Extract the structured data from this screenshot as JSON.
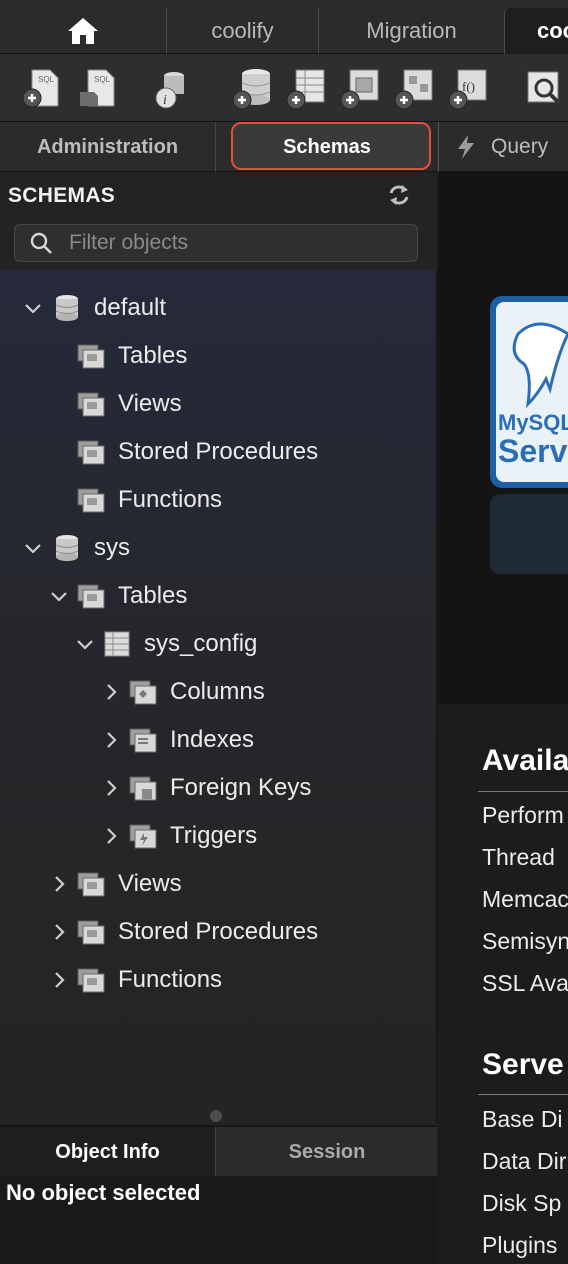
{
  "tabs": {
    "home_icon": "house-icon",
    "items": [
      {
        "label": "coolify"
      },
      {
        "label": "Migration"
      },
      {
        "label": "coo"
      }
    ]
  },
  "toolbar": {
    "buttons": [
      "new-sql-tab-icon",
      "open-sql-script-icon",
      "schema-inspector-icon",
      "create-schema-icon",
      "create-table-icon",
      "create-view-icon",
      "create-procedure-icon",
      "create-function-icon",
      "search-table-data-icon"
    ]
  },
  "sidebar_tabs": {
    "administration": "Administration",
    "schemas": "Schemas",
    "query": "Query"
  },
  "sidebar": {
    "title": "SCHEMAS",
    "filter_placeholder": "Filter objects",
    "tree": [
      {
        "label": "default",
        "kind": "schema",
        "expanded": true
      },
      {
        "label": "Tables",
        "kind": "folder"
      },
      {
        "label": "Views",
        "kind": "folder"
      },
      {
        "label": "Stored Procedures",
        "kind": "folder"
      },
      {
        "label": "Functions",
        "kind": "folder"
      },
      {
        "label": "sys",
        "kind": "schema",
        "expanded": true
      },
      {
        "label": "Tables",
        "kind": "folder",
        "expanded": true
      },
      {
        "label": "sys_config",
        "kind": "table",
        "expanded": true
      },
      {
        "label": "Columns",
        "kind": "columns",
        "expanded": false
      },
      {
        "label": "Indexes",
        "kind": "indexes",
        "expanded": false
      },
      {
        "label": "Foreign Keys",
        "kind": "foreign-keys",
        "expanded": false
      },
      {
        "label": "Triggers",
        "kind": "triggers",
        "expanded": false
      },
      {
        "label": "Views",
        "kind": "folder",
        "expanded": false
      },
      {
        "label": "Stored Procedures",
        "kind": "folder",
        "expanded": false
      },
      {
        "label": "Functions",
        "kind": "folder",
        "expanded": false
      }
    ]
  },
  "info_panel": {
    "tab_object": "Object Info",
    "tab_session": "Session",
    "message": "No object selected"
  },
  "main": {
    "logo_text_1": "MySQL",
    "logo_text_2": "Serv",
    "section_1_title": "Availa",
    "section_1_items": [
      "Perform",
      "Thread",
      "Memcac",
      "Semisyn",
      "SSL Ava"
    ],
    "section_2_title": "Serve",
    "section_2_items": [
      "Base Di",
      "Data Dir",
      "Disk Sp",
      "Plugins"
    ]
  },
  "colors": {
    "accent_ring": "#e0503b",
    "logo_blue": "#2a6fb5"
  }
}
